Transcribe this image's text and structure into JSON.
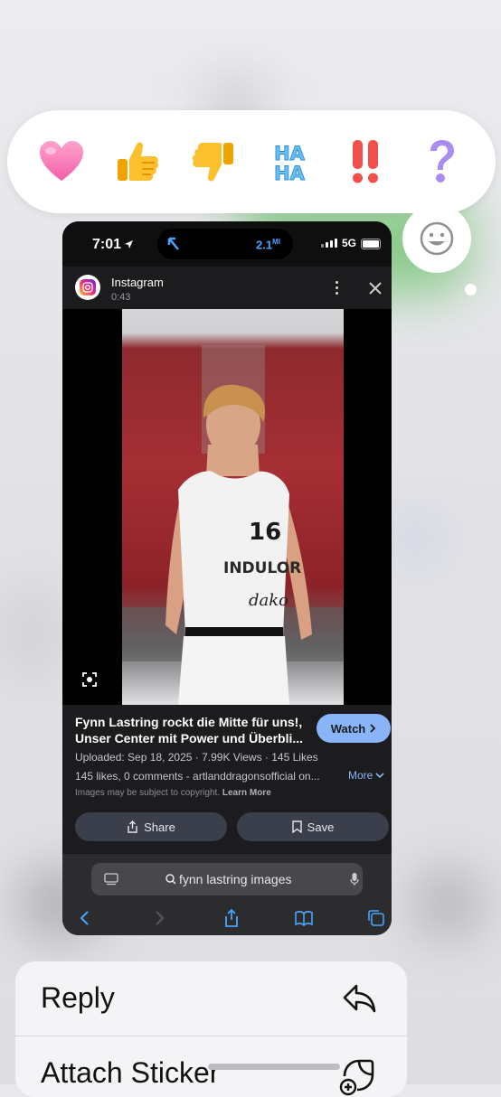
{
  "reactions": [
    "heart",
    "thumbs-up",
    "thumbs-down",
    "haha",
    "exclamation",
    "question",
    "add-reaction"
  ],
  "reactions_text": {
    "haha": "HA HA",
    "exclaim": "!!",
    "question": "?"
  },
  "card": {
    "status": {
      "time": "7:01",
      "distance": "2.1",
      "distance_unit": "MI",
      "network": "5G"
    },
    "source": {
      "name": "Instagram",
      "duration": "0:43"
    },
    "title": "Fynn Lastring rockt die Mitte für uns!, Unser Center mit Power und Überbli...",
    "watch_label": "Watch",
    "meta": "Uploaded: Sep 18, 2025 · 7.99K Views · 145 Likes",
    "description": "145 likes, 0 comments - artlanddragonsofficial on...",
    "more_label": "More",
    "copyright": "Images may be subject to copyright.",
    "learn_more": "Learn More",
    "share_label": "Share",
    "save_label": "Save",
    "search_query": "fynn lastring images"
  },
  "photo": {
    "jersey_number": "16",
    "jersey_brand": "INDULOR",
    "jersey_sponsor": "dako"
  },
  "menu": {
    "reply": "Reply",
    "attach_sticker": "Attach Sticker"
  },
  "colors": {
    "accent": "#8ab4f8",
    "reaction_bg": "#ffffff",
    "card_bg": "#1c1c1e"
  }
}
